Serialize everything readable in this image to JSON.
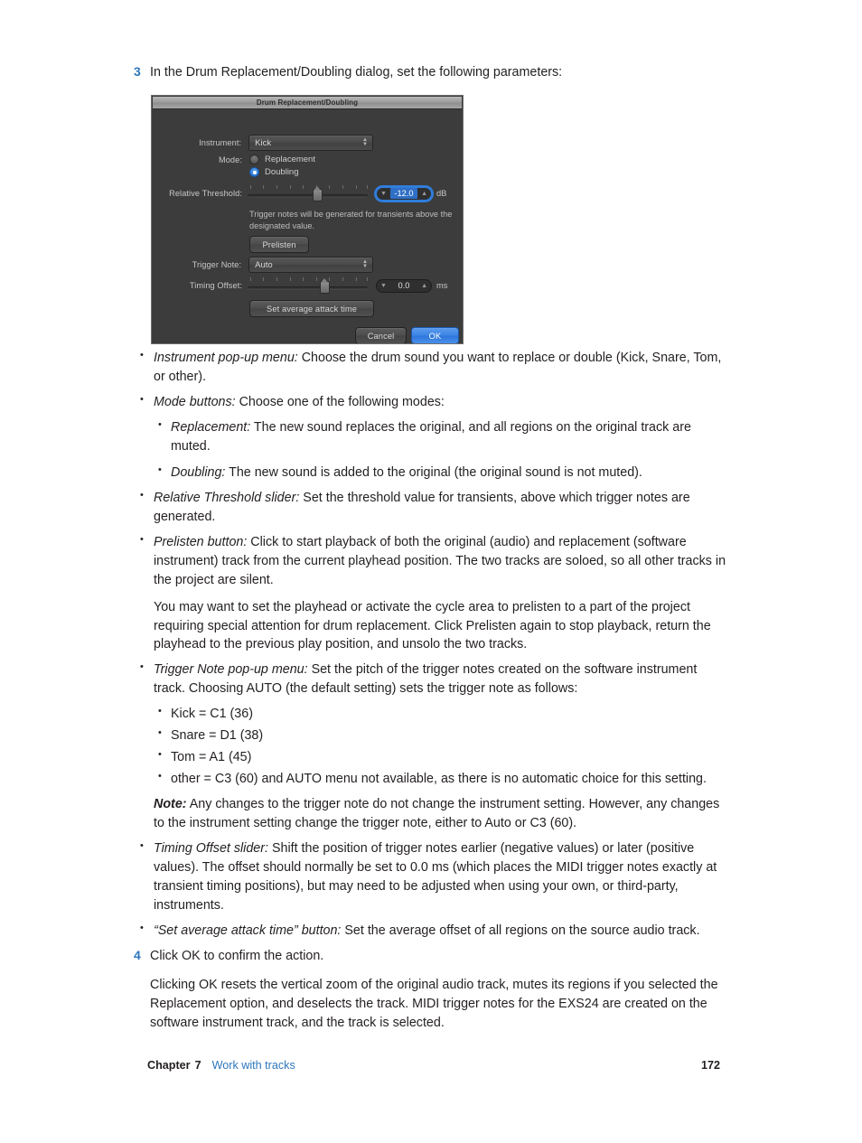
{
  "page": {
    "number": "172"
  },
  "steps": {
    "step3": {
      "num": "3",
      "text": "In the Drum Replacement/Doubling dialog, set the following parameters:"
    },
    "step4": {
      "num": "4",
      "text": "Click OK to confirm the action."
    }
  },
  "dialog": {
    "title": "Drum Replacement/Doubling",
    "instrument_label": "Instrument:",
    "instrument_value": "Kick",
    "mode_label": "Mode:",
    "mode_replacement": "Replacement",
    "mode_doubling": "Doubling",
    "mode_selected": "Doubling",
    "relative_threshold_label": "Relative Threshold:",
    "relative_threshold_value": "-12.0",
    "relative_threshold_unit": "dB",
    "help_text": "Trigger notes will be generated for transients above the designated value.",
    "prelisten_button": "Prelisten",
    "trigger_note_label": "Trigger Note:",
    "trigger_note_value": "Auto",
    "timing_offset_label": "Timing Offset:",
    "timing_offset_value": "0.0",
    "timing_offset_unit": "ms",
    "set_average_attack_button": "Set average attack time",
    "cancel_button": "Cancel",
    "ok_button": "OK",
    "colors": {
      "accent": "#2f7ddb",
      "window_bg": "#3c3c3c",
      "text": "#cfcfcf"
    }
  },
  "bullets": {
    "instrument": {
      "term": "Instrument pop-up menu:",
      "text": " Choose the drum sound you want to replace or double (Kick, Snare, Tom, or other)."
    },
    "mode": {
      "term": "Mode buttons:",
      "text": " Choose one of the following modes:"
    },
    "replacement": {
      "term": "Replacement:",
      "text": " The new sound replaces the original, and all regions on the original track are muted."
    },
    "doubling": {
      "term": "Doubling:",
      "text": " The new sound is added to the original (the original sound is not muted)."
    },
    "relative_threshold": {
      "term": "Relative Threshold slider:",
      "text": " Set the threshold value for transients, above which trigger notes are generated."
    },
    "prelisten": {
      "term": "Prelisten button:",
      "text": " Click to start playback of both the original (audio) and replacement (software instrument) track from the current playhead position. The two tracks are soloed, so all other tracks in the project are silent."
    },
    "prelisten_para": "You may want to set the playhead or activate the cycle area to prelisten to a part of the project requiring special attention for drum replacement. Click Prelisten again to stop playback, return the playhead to the previous play position, and unsolo the two tracks.",
    "trigger_note": {
      "term": "Trigger Note pop-up menu:",
      "text": " Set the pitch of the trigger notes created on the software instrument track. Choosing AUTO (the default setting) sets the trigger note as follows:"
    },
    "notes": [
      "Kick = C1 (36)",
      "Snare = D1 (38)",
      "Tom = A1 (45)",
      "other = C3 (60) and AUTO menu not available, as there is no automatic choice for this setting."
    ],
    "note": {
      "label": "Note:",
      "text": "  Any changes to the trigger note do not change the instrument setting. However, any changes to the instrument setting change the trigger note, either to Auto or C3 (60)."
    },
    "timing_offset": {
      "term": "Timing Offset slider:",
      "text": " Shift the position of trigger notes earlier (negative values) or later (positive values). The offset should normally be set to 0.0 ms (which places the MIDI trigger notes exactly at transient timing positions), but may need to be adjusted when using your own, or third-party, instruments."
    },
    "set_average": {
      "term": "“Set average attack time” button:",
      "text": " Set the average offset of all regions on the source audio track."
    }
  },
  "closing_para": "Clicking OK resets the vertical zoom of the original audio track, mutes its regions if you selected the Replacement option, and deselects the track. MIDI trigger notes for the EXS24 are created on the software instrument track, and the track is selected.",
  "footer": {
    "chapter_word": "Chapter",
    "chapter_num": "7",
    "chapter_title": "Work with tracks",
    "page_number": "172"
  }
}
